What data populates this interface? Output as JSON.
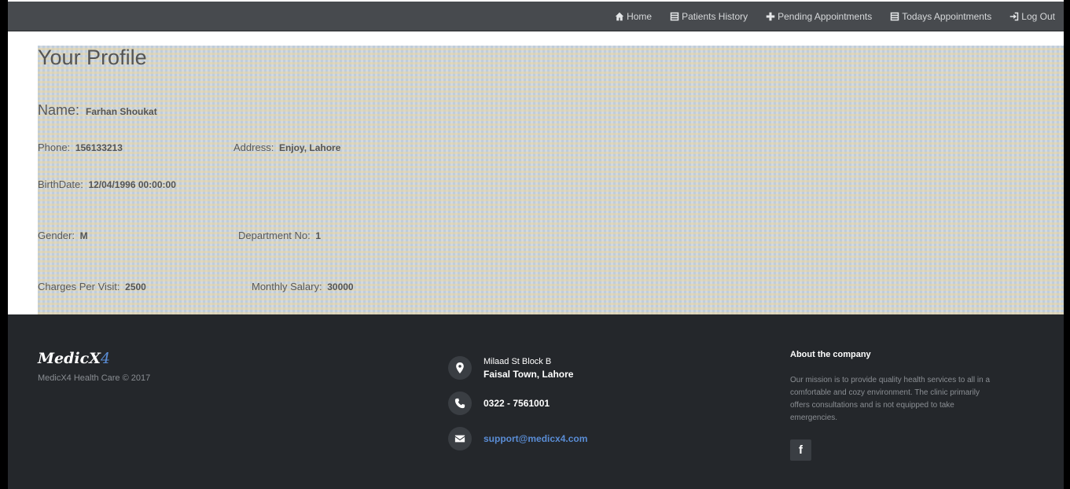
{
  "nav": {
    "home": "Home",
    "patients_history": "Patients History",
    "pending_appointments": "Pending Appointments",
    "todays_appointments": "Todays Appointments",
    "logout": "Log Out"
  },
  "profile": {
    "title": "Your Profile",
    "name_label": "Name:",
    "name_value": "Farhan Shoukat",
    "phone_label": "Phone:",
    "phone_value": "156133213",
    "address_label": "Address:",
    "address_value": "Enjoy, Lahore",
    "birthdate_label": "BirthDate:",
    "birthdate_value": "12/04/1996 00:00:00",
    "gender_label": "Gender:",
    "gender_value": "M",
    "department_label": "Department No:",
    "department_value": "1",
    "charges_label": "Charges Per Visit:",
    "charges_value": "2500",
    "salary_label": "Monthly Salary:",
    "salary_value": "30000"
  },
  "footer": {
    "logo_main": "MedicX",
    "logo_accent": "4",
    "copyright": "MedicX4 Health Care © 2017",
    "address_line1": "Milaad St Block B",
    "address_line2": "Faisal Town, Lahore",
    "phone": "0322 - 7561001",
    "email": "support@medicx4.com",
    "about_title": "About the company",
    "about_text": "Our mission is to provide quality health services to all in a comfortable and cozy environment. The clinic primarily offers consultations and is not equipped to take emergencies.",
    "facebook_glyph": "f"
  },
  "colors": {
    "navbar_bg": "#474a4e",
    "footer_bg": "#24272b",
    "accent_blue": "#5a8dd6"
  },
  "icons": {
    "home": "home-icon",
    "patients_history": "list-icon",
    "pending_appointments": "plus-icon",
    "todays_appointments": "list-icon",
    "logout": "logout-icon",
    "address": "map-pin-icon",
    "phone": "phone-icon",
    "email": "envelope-icon",
    "facebook": "facebook-icon"
  }
}
